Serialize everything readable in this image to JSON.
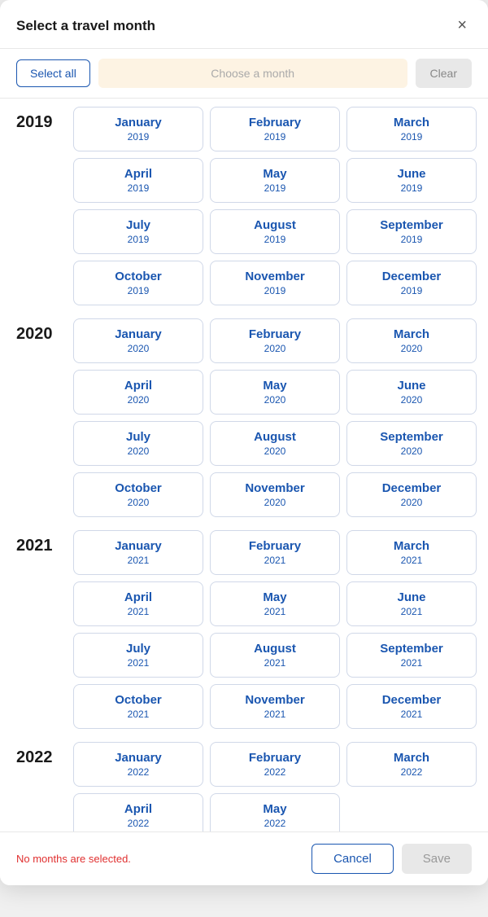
{
  "modal": {
    "title": "Select a travel month",
    "close_label": "×"
  },
  "toolbar": {
    "select_all_label": "Select all",
    "choose_month_placeholder": "Choose a month",
    "clear_label": "Clear"
  },
  "years": [
    {
      "year": "2019",
      "months": [
        {
          "name": "January",
          "year": "2019"
        },
        {
          "name": "February",
          "year": "2019"
        },
        {
          "name": "March",
          "year": "2019"
        },
        {
          "name": "April",
          "year": "2019"
        },
        {
          "name": "May",
          "year": "2019"
        },
        {
          "name": "June",
          "year": "2019"
        },
        {
          "name": "July",
          "year": "2019"
        },
        {
          "name": "August",
          "year": "2019"
        },
        {
          "name": "September",
          "year": "2019"
        },
        {
          "name": "October",
          "year": "2019"
        },
        {
          "name": "November",
          "year": "2019"
        },
        {
          "name": "December",
          "year": "2019"
        }
      ]
    },
    {
      "year": "2020",
      "months": [
        {
          "name": "January",
          "year": "2020"
        },
        {
          "name": "February",
          "year": "2020"
        },
        {
          "name": "March",
          "year": "2020"
        },
        {
          "name": "April",
          "year": "2020"
        },
        {
          "name": "May",
          "year": "2020"
        },
        {
          "name": "June",
          "year": "2020"
        },
        {
          "name": "July",
          "year": "2020"
        },
        {
          "name": "August",
          "year": "2020"
        },
        {
          "name": "September",
          "year": "2020"
        },
        {
          "name": "October",
          "year": "2020"
        },
        {
          "name": "November",
          "year": "2020"
        },
        {
          "name": "December",
          "year": "2020"
        }
      ]
    },
    {
      "year": "2021",
      "months": [
        {
          "name": "January",
          "year": "2021"
        },
        {
          "name": "February",
          "year": "2021"
        },
        {
          "name": "March",
          "year": "2021"
        },
        {
          "name": "April",
          "year": "2021"
        },
        {
          "name": "May",
          "year": "2021"
        },
        {
          "name": "June",
          "year": "2021"
        },
        {
          "name": "July",
          "year": "2021"
        },
        {
          "name": "August",
          "year": "2021"
        },
        {
          "name": "September",
          "year": "2021"
        },
        {
          "name": "October",
          "year": "2021"
        },
        {
          "name": "November",
          "year": "2021"
        },
        {
          "name": "December",
          "year": "2021"
        }
      ]
    },
    {
      "year": "2022",
      "months": [
        {
          "name": "January",
          "year": "2022"
        },
        {
          "name": "February",
          "year": "2022"
        },
        {
          "name": "March",
          "year": "2022"
        },
        {
          "name": "April",
          "year": "2022"
        },
        {
          "name": "May",
          "year": "2022"
        }
      ]
    }
  ],
  "footer": {
    "status": "No months are selected.",
    "cancel_label": "Cancel",
    "save_label": "Save"
  }
}
